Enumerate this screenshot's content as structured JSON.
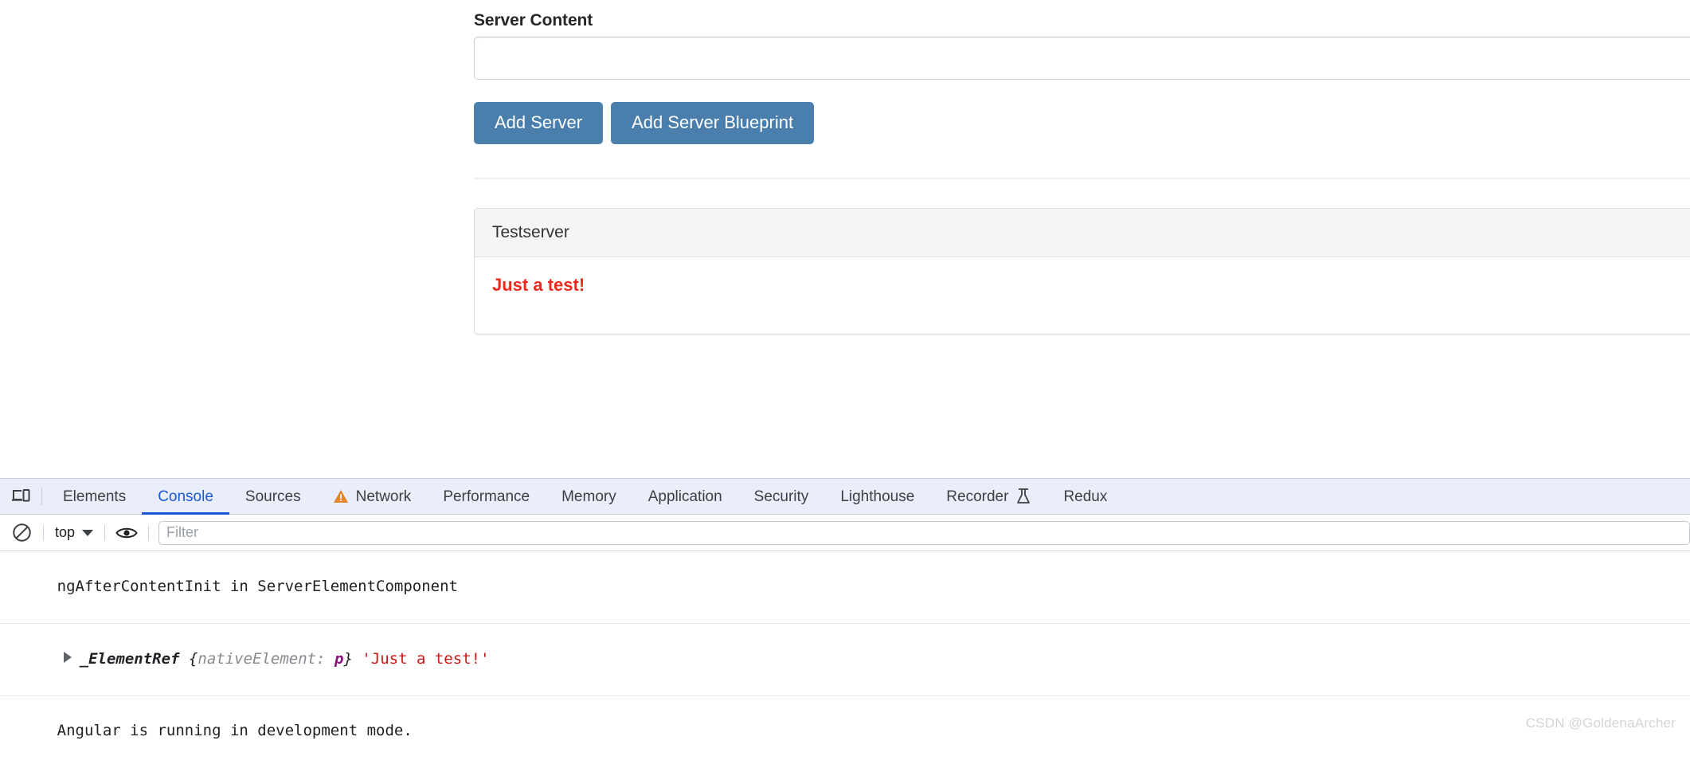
{
  "page": {
    "server_name_input": {
      "value": "",
      "placeholder": ""
    },
    "server_content_label": "Server Content",
    "server_content_input": {
      "value": "",
      "placeholder": ""
    },
    "buttons": {
      "add_server": "Add Server",
      "add_server_blueprint": "Add Server Blueprint"
    },
    "panel": {
      "heading": "Testserver",
      "body_text": "Just a test!",
      "body_text_color": "#ed2b1c"
    }
  },
  "devtools": {
    "device_toolbar_icon": "device-toolbar-icon",
    "tabs": [
      {
        "label": "Elements",
        "active": false,
        "icon": null
      },
      {
        "label": "Console",
        "active": true,
        "icon": null
      },
      {
        "label": "Sources",
        "active": false,
        "icon": null
      },
      {
        "label": "Network",
        "active": false,
        "icon": "warning-triangle-icon"
      },
      {
        "label": "Performance",
        "active": false,
        "icon": null
      },
      {
        "label": "Memory",
        "active": false,
        "icon": null
      },
      {
        "label": "Application",
        "active": false,
        "icon": null
      },
      {
        "label": "Security",
        "active": false,
        "icon": null
      },
      {
        "label": "Lighthouse",
        "active": false,
        "icon": null
      },
      {
        "label": "Recorder",
        "active": false,
        "icon": "flask-icon"
      },
      {
        "label": "Redux",
        "active": false,
        "icon": null
      }
    ],
    "active_tab_color": "#1a56d6",
    "warning_icon_color": "#e8842a",
    "console_toolbar": {
      "clear_icon": "clear-console-icon",
      "context": "top",
      "eye_icon": "eye-icon",
      "filter": {
        "value": "",
        "placeholder": "Filter"
      }
    },
    "messages": [
      {
        "type": "plain",
        "text": "ngAfterContentInit in ServerElementComponent"
      },
      {
        "type": "object",
        "expandable": true,
        "class_name": "_ElementRef",
        "brace_open": "{",
        "prop_name": "nativeElement",
        "prop_sep": ": ",
        "prop_value": "p",
        "brace_close": "}",
        "trailing_string": "'Just a test!'"
      },
      {
        "type": "plain",
        "text": "Angular is running in development mode."
      }
    ]
  },
  "watermark": "CSDN @GoldenaArcher"
}
